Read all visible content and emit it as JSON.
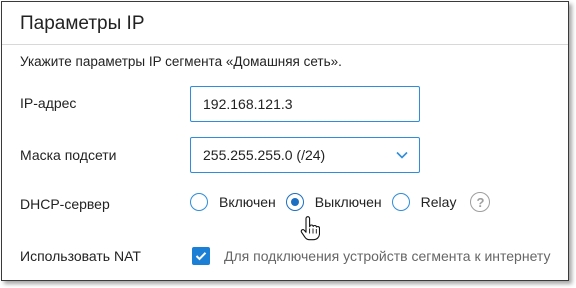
{
  "panel": {
    "title": "Параметры IP",
    "description": "Укажите параметры IP сегмента «Домашняя сеть»."
  },
  "ip": {
    "label": "IP-адрес",
    "value": "192.168.121.3"
  },
  "mask": {
    "label": "Маска подсети",
    "value": "255.255.255.0 (/24)"
  },
  "dhcp": {
    "label": "DHCP-сервер",
    "options": [
      {
        "label": "Включен",
        "selected": false
      },
      {
        "label": "Выключен",
        "selected": true
      },
      {
        "label": "Relay",
        "selected": false
      }
    ],
    "help_icon": "question-circle-icon"
  },
  "nat": {
    "label": "Использовать NAT",
    "checked": true,
    "checkbox_label": "Для подключения устройств сегмента к интернету"
  },
  "colors": {
    "accent": "#1b7fd6",
    "field_border": "#2f8ddb",
    "muted_text": "#666666"
  }
}
